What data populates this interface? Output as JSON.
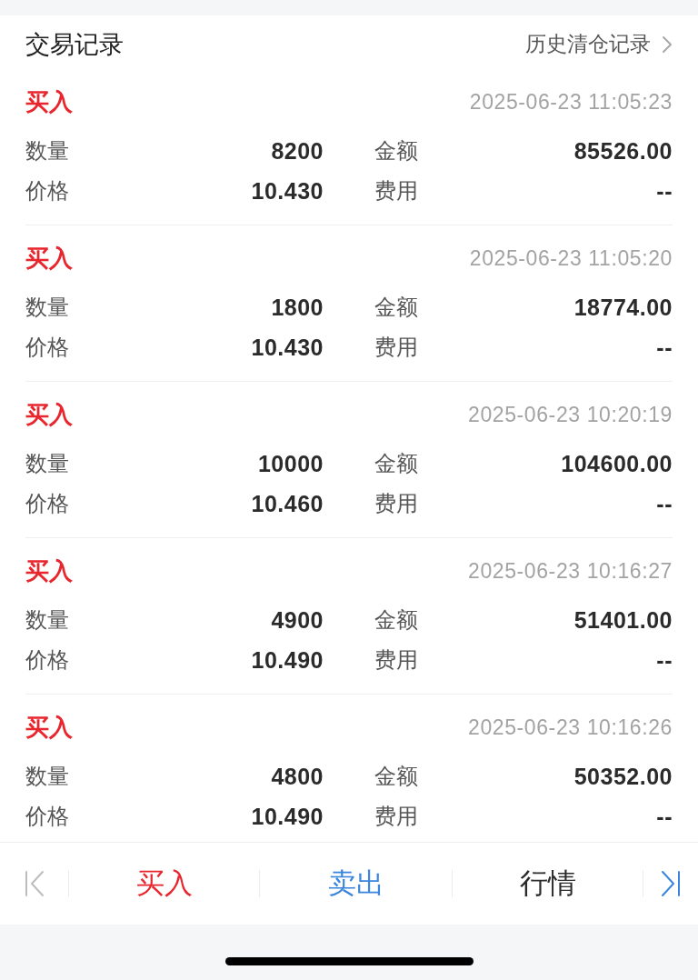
{
  "header": {
    "title": "交易记录",
    "history_link": "历史清仓记录"
  },
  "records": [
    {
      "kind": "buy",
      "type": "买入",
      "datetime": "2025-06-23 11:05:23",
      "fields": [
        {
          "label": "数量",
          "value": "8200"
        },
        {
          "label": "金额",
          "value": "85526.00"
        },
        {
          "label": "价格",
          "value": "10.430"
        },
        {
          "label": "费用",
          "value": "--"
        }
      ]
    },
    {
      "kind": "buy",
      "type": "买入",
      "datetime": "2025-06-23 11:05:20",
      "fields": [
        {
          "label": "数量",
          "value": "1800"
        },
        {
          "label": "金额",
          "value": "18774.00"
        },
        {
          "label": "价格",
          "value": "10.430"
        },
        {
          "label": "费用",
          "value": "--"
        }
      ]
    },
    {
      "kind": "buy",
      "type": "买入",
      "datetime": "2025-06-23 10:20:19",
      "fields": [
        {
          "label": "数量",
          "value": "10000"
        },
        {
          "label": "金额",
          "value": "104600.00"
        },
        {
          "label": "价格",
          "value": "10.460"
        },
        {
          "label": "费用",
          "value": "--"
        }
      ]
    },
    {
      "kind": "buy",
      "type": "买入",
      "datetime": "2025-06-23 10:16:27",
      "fields": [
        {
          "label": "数量",
          "value": "4900"
        },
        {
          "label": "金额",
          "value": "51401.00"
        },
        {
          "label": "价格",
          "value": "10.490"
        },
        {
          "label": "费用",
          "value": "--"
        }
      ]
    },
    {
      "kind": "buy",
      "type": "买入",
      "datetime": "2025-06-23 10:16:26",
      "fields": [
        {
          "label": "数量",
          "value": "4800"
        },
        {
          "label": "金额",
          "value": "50352.00"
        },
        {
          "label": "价格",
          "value": "10.490"
        },
        {
          "label": "费用",
          "value": "--"
        }
      ]
    }
  ],
  "toolbar": {
    "first_page": {
      "disabled": true
    },
    "actions": [
      {
        "kind": "buy",
        "label": "买入"
      },
      {
        "kind": "sell",
        "label": "卖出"
      },
      {
        "kind": "quote",
        "label": "行情"
      }
    ],
    "last_page": {
      "disabled": false
    }
  }
}
